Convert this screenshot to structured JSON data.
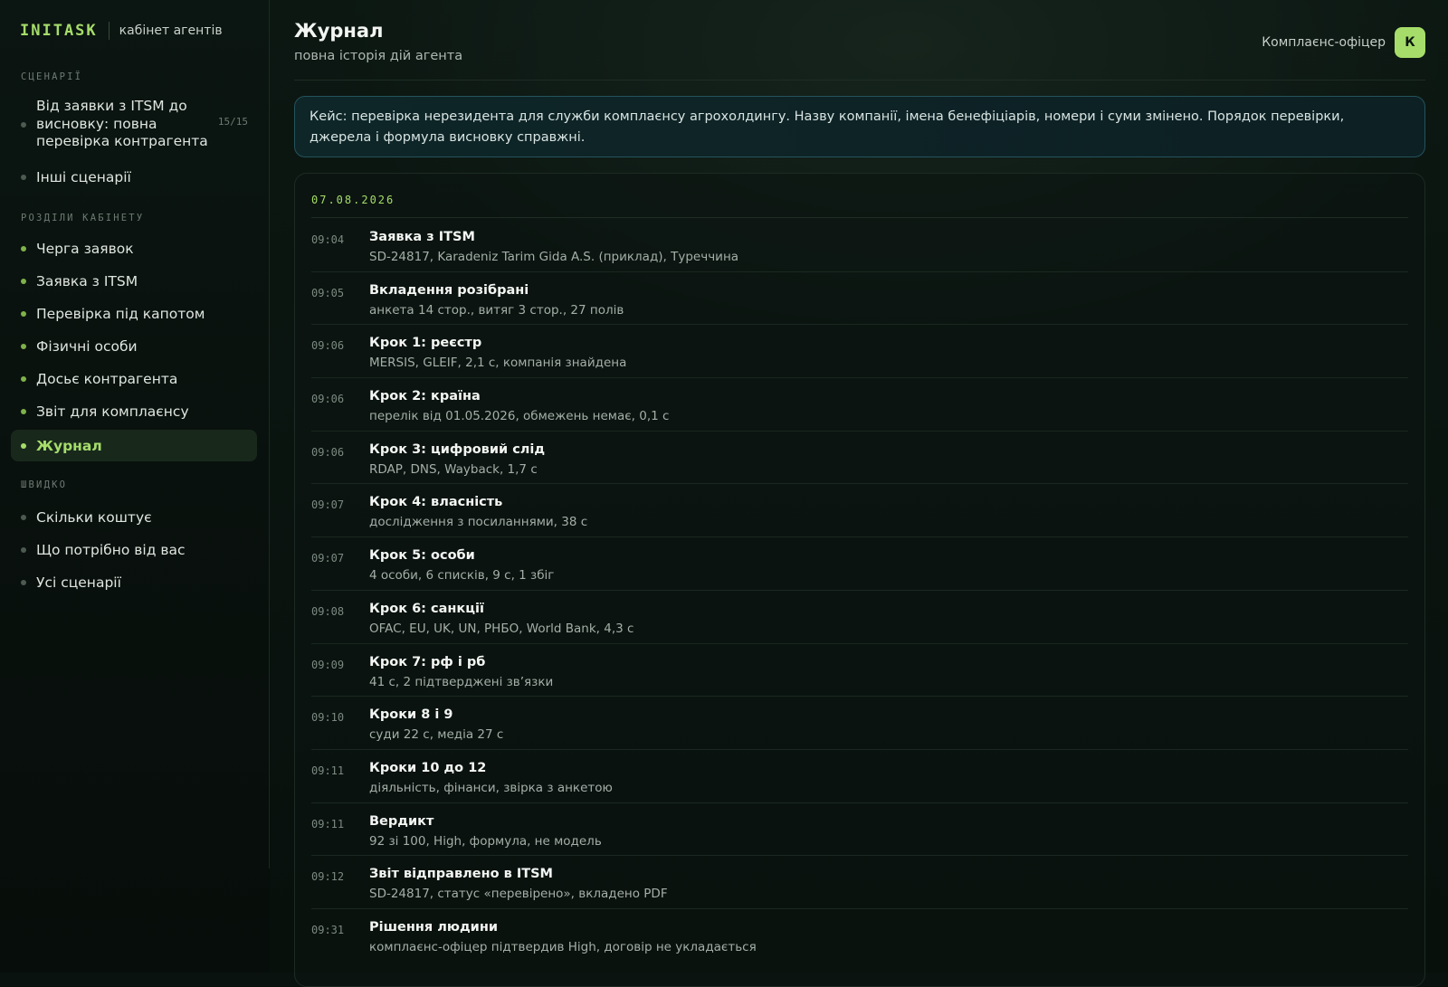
{
  "brand": {
    "logo": "INITASK",
    "subtitle": "кабінет агентів"
  },
  "sidebar": {
    "sections": [
      {
        "label": "СЦЕНАРІЇ"
      },
      {
        "label": "РОЗДІЛИ КАБІНЕТУ"
      },
      {
        "label": "ШВИДКО"
      }
    ],
    "scenarios": [
      {
        "label": "Від заявки з ITSM до висновку: повна перевірка контрагента",
        "count": "15/15"
      },
      {
        "label": "Інші сценарії"
      }
    ],
    "cabinet": [
      {
        "label": "Черга заявок"
      },
      {
        "label": "Заявка з ITSM"
      },
      {
        "label": "Перевірка під капотом"
      },
      {
        "label": "Фізичні особи"
      },
      {
        "label": "Досьє контрагента"
      },
      {
        "label": "Звіт для комплаєнсу"
      },
      {
        "label": "Журнал",
        "active": true
      }
    ],
    "quick": [
      {
        "label": "Скільки коштує"
      },
      {
        "label": "Що потрібно від вас"
      },
      {
        "label": "Усі сценарії"
      }
    ]
  },
  "header": {
    "title": "Журнал",
    "subtitle": "повна історія дій агента",
    "user_role": "Комплаєнс-офіцер",
    "avatar_letter": "К"
  },
  "case_note": "Кейс: перевірка нерезидента для служби комплаєнсу агрохолдингу. Назву компанії, імена бенефіціарів, номери і суми змінено. Порядок перевірки, джерела і формула висновку справжні.",
  "log": {
    "date": "07.08.2026",
    "entries": [
      {
        "time": "09:04",
        "title": "Заявка з ITSM",
        "detail": "SD-24817, Karadeniz Tarim Gida A.S. (приклад), Туреччина"
      },
      {
        "time": "09:05",
        "title": "Вкладення розібрані",
        "detail": "анкета 14 стор., витяг 3 стор., 27 полів"
      },
      {
        "time": "09:06",
        "title": "Крок 1: реєстр",
        "detail": "MERSIS, GLEIF, 2,1 с, компанія знайдена"
      },
      {
        "time": "09:06",
        "title": "Крок 2: країна",
        "detail": "перелік від 01.05.2026, обмежень немає, 0,1 с"
      },
      {
        "time": "09:06",
        "title": "Крок 3: цифровий слід",
        "detail": "RDAP, DNS, Wayback, 1,7 с"
      },
      {
        "time": "09:07",
        "title": "Крок 4: власність",
        "detail": "дослідження з посиланнями, 38 с"
      },
      {
        "time": "09:07",
        "title": "Крок 5: особи",
        "detail": "4 особи, 6 списків, 9 с, 1 збіг"
      },
      {
        "time": "09:08",
        "title": "Крок 6: санкції",
        "detail": "OFAC, EU, UK, UN, РНБО, World Bank, 4,3 с"
      },
      {
        "time": "09:09",
        "title": "Крок 7: рф і рб",
        "detail": "41 с, 2 підтверджені зв’язки"
      },
      {
        "time": "09:10",
        "title": "Кроки 8 і 9",
        "detail": "суди 22 с, медіа 27 с"
      },
      {
        "time": "09:11",
        "title": "Кроки 10 до 12",
        "detail": "діяльність, фінанси, звірка з анкетою"
      },
      {
        "time": "09:11",
        "title": "Вердикт",
        "detail": "92 зі 100, High, формула, не модель"
      },
      {
        "time": "09:12",
        "title": "Звіт відправлено в ITSM",
        "detail": "SD-24817, статус «перевірено», вкладено PDF"
      },
      {
        "time": "09:31",
        "title": "Рішення людини",
        "detail": "комплаєнс-офіцер підтвердив High, договір не укладається"
      }
    ]
  }
}
